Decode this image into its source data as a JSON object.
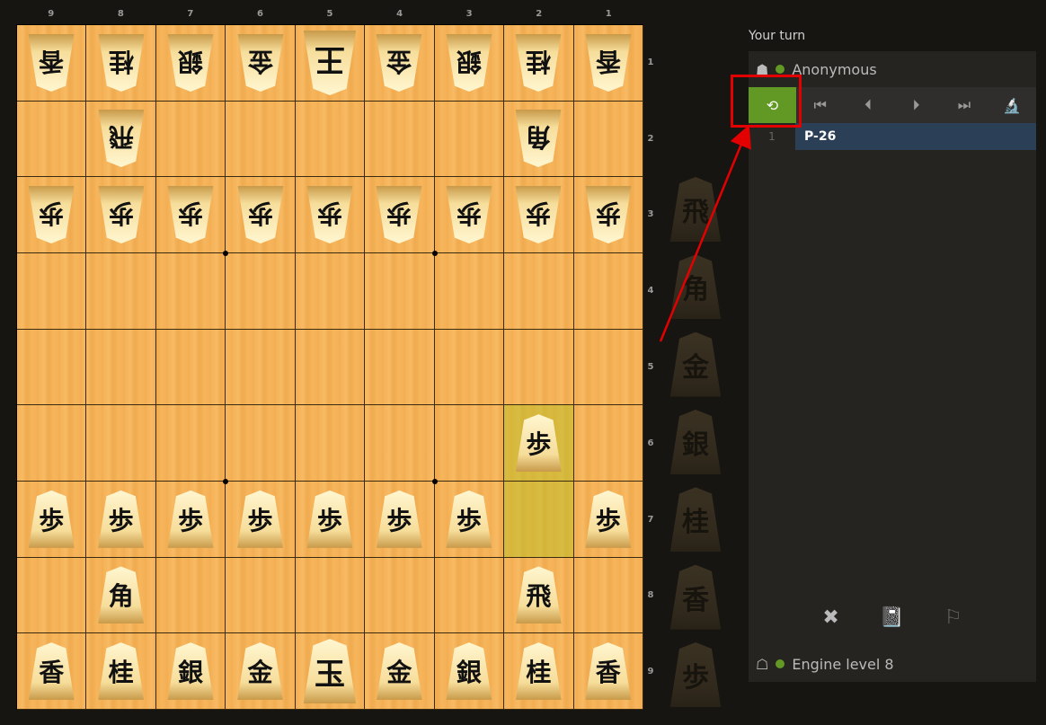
{
  "files": [
    "9",
    "8",
    "7",
    "6",
    "5",
    "4",
    "3",
    "2",
    "1"
  ],
  "ranks": [
    "1",
    "2",
    "3",
    "4",
    "5",
    "6",
    "7",
    "8",
    "9"
  ],
  "board": [
    [
      {
        "c": "香",
        "g": true
      },
      {
        "c": "桂",
        "g": true
      },
      {
        "c": "銀",
        "g": true
      },
      {
        "c": "金",
        "g": true
      },
      {
        "c": "王",
        "g": true,
        "k": true
      },
      {
        "c": "金",
        "g": true
      },
      {
        "c": "銀",
        "g": true
      },
      {
        "c": "桂",
        "g": true
      },
      {
        "c": "香",
        "g": true
      }
    ],
    [
      null,
      {
        "c": "飛",
        "g": true
      },
      null,
      null,
      null,
      null,
      null,
      {
        "c": "角",
        "g": true
      },
      null
    ],
    [
      {
        "c": "歩",
        "g": true
      },
      {
        "c": "歩",
        "g": true
      },
      {
        "c": "歩",
        "g": true
      },
      {
        "c": "歩",
        "g": true
      },
      {
        "c": "歩",
        "g": true
      },
      {
        "c": "歩",
        "g": true
      },
      {
        "c": "歩",
        "g": true
      },
      {
        "c": "歩",
        "g": true
      },
      {
        "c": "歩",
        "g": true
      }
    ],
    [
      null,
      null,
      null,
      null,
      null,
      null,
      null,
      null,
      null
    ],
    [
      null,
      null,
      null,
      null,
      null,
      null,
      null,
      null,
      null
    ],
    [
      null,
      null,
      null,
      null,
      null,
      null,
      null,
      {
        "c": "歩"
      },
      null
    ],
    [
      {
        "c": "歩"
      },
      {
        "c": "歩"
      },
      {
        "c": "歩"
      },
      {
        "c": "歩"
      },
      {
        "c": "歩"
      },
      {
        "c": "歩"
      },
      {
        "c": "歩"
      },
      null,
      {
        "c": "歩"
      }
    ],
    [
      null,
      {
        "c": "角"
      },
      null,
      null,
      null,
      null,
      null,
      {
        "c": "飛"
      },
      null
    ],
    [
      {
        "c": "香"
      },
      {
        "c": "桂"
      },
      {
        "c": "銀"
      },
      {
        "c": "金"
      },
      {
        "c": "玉",
        "k": true
      },
      {
        "c": "金"
      },
      {
        "c": "銀"
      },
      {
        "c": "桂"
      },
      {
        "c": "香"
      }
    ]
  ],
  "highlights": [
    [
      5,
      7
    ],
    [
      6,
      7
    ]
  ],
  "hand_pieces": [
    "飛",
    "角",
    "金",
    "銀",
    "桂",
    "香",
    "歩"
  ],
  "status": {
    "turn_label": "Your turn"
  },
  "players": {
    "top": "Anonymous",
    "bottom": "Engine level 8"
  },
  "controls": [
    {
      "name": "flip-board-button",
      "glyph": "⟲",
      "active": true
    },
    {
      "name": "first-move-button",
      "glyph": "⏮",
      "active": false
    },
    {
      "name": "prev-move-button",
      "glyph": "⏴",
      "active": false
    },
    {
      "name": "next-move-button",
      "glyph": "⏵",
      "active": false
    },
    {
      "name": "last-move-button",
      "glyph": "⏭",
      "active": false
    },
    {
      "name": "analysis-button",
      "glyph": "🔬",
      "active": false
    }
  ],
  "moves": [
    {
      "num": "1",
      "san": "P-26"
    }
  ],
  "actions": {
    "abort": "✖",
    "book": "📓",
    "resign": "⚐"
  },
  "colors": {
    "accent_green": "#629924",
    "annotation_red": "#e30000",
    "move_highlight": "#2b4057"
  }
}
